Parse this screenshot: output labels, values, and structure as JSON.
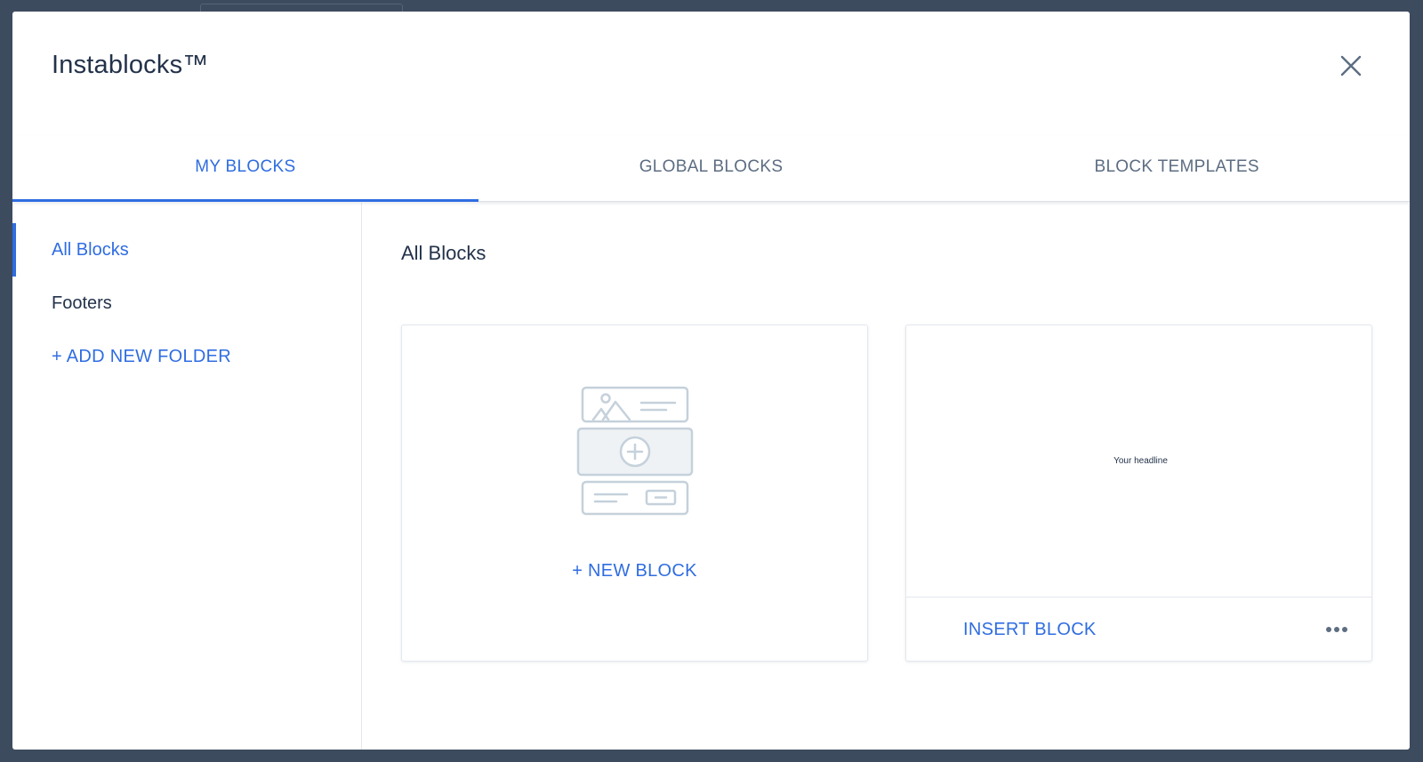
{
  "modal": {
    "title": "Instablocks™",
    "close_icon": "close-icon"
  },
  "tabs": [
    {
      "label": "MY BLOCKS",
      "active": true
    },
    {
      "label": "GLOBAL BLOCKS",
      "active": false
    },
    {
      "label": "BLOCK TEMPLATES",
      "active": false
    }
  ],
  "sidebar": {
    "items": [
      {
        "label": "All Blocks",
        "active": true
      },
      {
        "label": "Footers",
        "active": false
      }
    ],
    "add_folder_label": "+ ADD NEW FOLDER"
  },
  "main": {
    "title": "All Blocks",
    "new_block": {
      "label": "+ NEW BLOCK",
      "icon": "block-placeholder-icon"
    },
    "saved_block": {
      "preview_text": "Your headline",
      "insert_label": "INSERT BLOCK",
      "more_icon": "more-options-icon"
    }
  },
  "colors": {
    "accent": "#2f6de1",
    "text": "#23324a",
    "muted": "#5d6d82",
    "backdrop": "#3d4b5e"
  }
}
